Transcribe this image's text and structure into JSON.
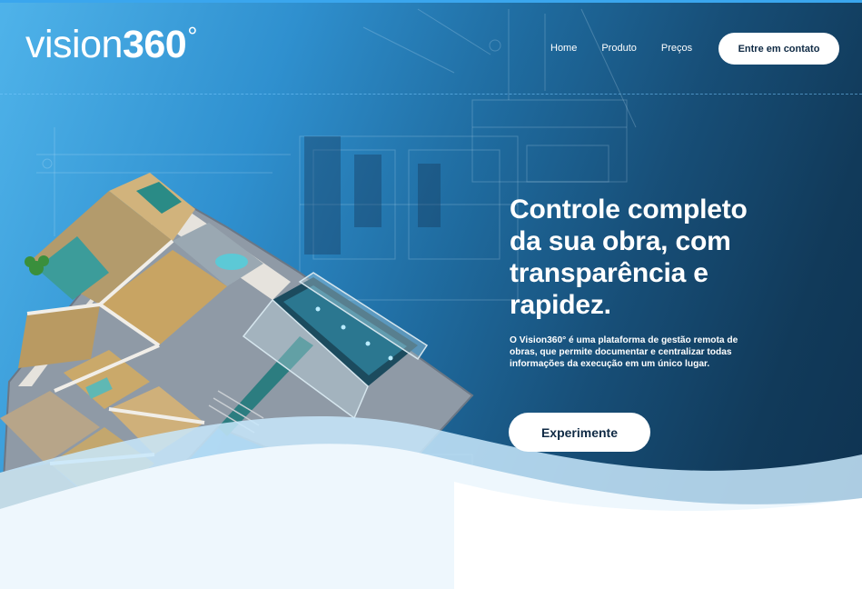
{
  "brand": {
    "name_light": "vision",
    "name_bold": "360",
    "degree": "°"
  },
  "nav": {
    "items": [
      {
        "label": "Home"
      },
      {
        "label": "Produto"
      },
      {
        "label": "Preços"
      }
    ],
    "contact_label": "Entre em contato"
  },
  "hero": {
    "headline": "Controle completo da sua obra, com transparência e rapidez.",
    "description": "O Vision360° é uma plataforma de gestão remota de obras, que permite documentar e centralizar todas informações da execução em um único lugar.",
    "cta_label": "Experimente"
  },
  "colors": {
    "gradient_light": "#4fb3ea",
    "gradient_dark": "#0e3250",
    "wave_light": "#c8e8fb",
    "button_bg": "#ffffff",
    "button_text": "#0f2a44"
  }
}
